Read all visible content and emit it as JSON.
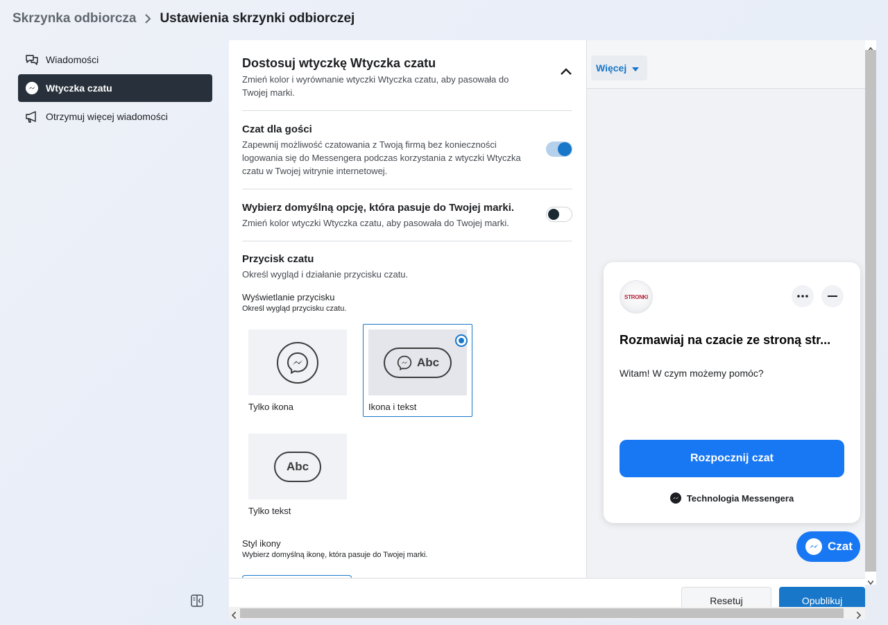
{
  "breadcrumb": {
    "parent": "Skrzynka odbiorcza",
    "current": "Ustawienia skrzynki odbiorczej"
  },
  "sidebar": {
    "items": [
      {
        "label": "Wiadomości",
        "icon": "chat-bubbles-icon",
        "active": false
      },
      {
        "label": "Wtyczka czatu",
        "icon": "messenger-icon",
        "active": true
      },
      {
        "label": "Otrzymuj więcej wiadomości",
        "icon": "megaphone-icon",
        "active": false
      }
    ]
  },
  "settings": {
    "section_title": "Dostosuj wtyczkę Wtyczka czatu",
    "section_desc": "Zmień kolor i wyrównanie wtyczki Wtyczka czatu, aby pasowała do Twojej marki.",
    "guest_chat": {
      "title": "Czat dla gości",
      "desc": "Zapewnij możliwość czatowania z Twoją firmą bez konieczności logowania się do Messengera podczas korzystania z wtyczki Wtyczka czatu w Twojej witrynie internetowej.",
      "enabled": true
    },
    "default_option": {
      "title": "Wybierz domyślną opcję, która pasuje do Twojej marki.",
      "desc": "Zmień kolor wtyczki Wtyczka czatu, aby pasowała do Twojej marki.",
      "enabled": false
    },
    "chat_button": {
      "title": "Przycisk czatu",
      "desc": "Określ wygląd i działanie przycisku czatu."
    },
    "button_display": {
      "label": "Wyświetlanie przycisku",
      "hint": "Określ wygląd przycisku czatu.",
      "options": [
        {
          "label": "Tylko ikona",
          "selected": false
        },
        {
          "label": "Ikona i tekst",
          "selected": true,
          "sample": "Abc"
        },
        {
          "label": "Tylko tekst",
          "selected": false,
          "sample": "Abc"
        }
      ]
    },
    "icon_style": {
      "label": "Styl ikony",
      "hint": "Wybierz domyślną ikonę, która pasuje do Twojej marki."
    }
  },
  "preview": {
    "more_label": "Więcej",
    "avatar_text": "STRONKI",
    "chat_title": "Rozmawiaj na czacie ze stroną str...",
    "greeting": "Witam! W czym możemy pomóc?",
    "start_button": "Rozpocznij czat",
    "powered_by": "Technologia Messengera",
    "fab_label": "Czat"
  },
  "footer": {
    "reset": "Resetuj",
    "publish": "Opublikuj"
  },
  "colors": {
    "accent": "#1877c9",
    "messenger_blue": "#1877f2",
    "sidebar_active": "#28313b"
  }
}
